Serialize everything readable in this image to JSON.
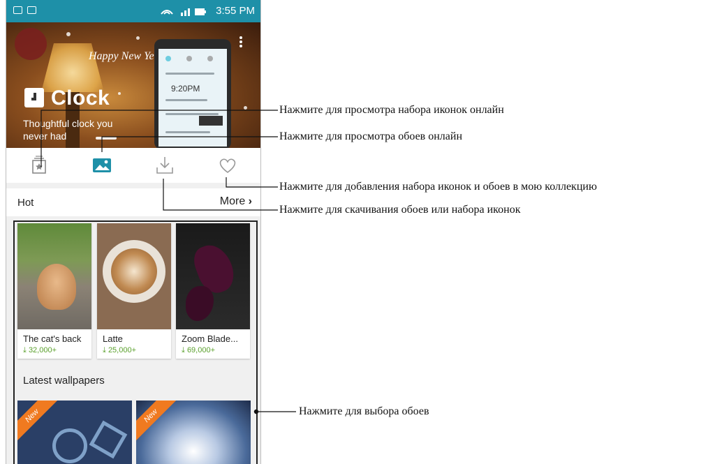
{
  "status_bar": {
    "time": "3:55 PM"
  },
  "banner": {
    "greeting": "Happy New Year",
    "title": "Clock",
    "subtitle": "Thoughtful clock you never had",
    "mock_time": "9:20PM"
  },
  "tabs": [
    {
      "name": "tab-icon-packs",
      "icon": "icon-pack-icon"
    },
    {
      "name": "tab-wallpapers",
      "icon": "image-icon",
      "selected": true
    },
    {
      "name": "tab-downloads",
      "icon": "download-icon"
    },
    {
      "name": "tab-favorites",
      "icon": "heart-icon"
    }
  ],
  "hot": {
    "title": "Hot",
    "more_label": "More",
    "items": [
      {
        "title": "The cat's back",
        "count": "32,000+"
      },
      {
        "title": "Latte",
        "count": "25,000+"
      },
      {
        "title": "Zoom Blade...",
        "count": "69,000+"
      }
    ]
  },
  "latest": {
    "title": "Latest wallpapers",
    "items": [
      {
        "badge": "New"
      },
      {
        "badge": "New"
      }
    ]
  },
  "callouts": {
    "icon_packs_online": "Нажмите для просмотра набора иконок онлайн",
    "wallpapers_online": "Нажмите для просмотра обоев онлайн",
    "add_to_collection": "Нажмите для добавления набора иконок и обоев в мою коллекцию",
    "download": "Нажмите для скачивания обоев или набора иконок",
    "select_wallpaper": "Нажмите для выбора обоев"
  },
  "colors": {
    "accent": "#1e90a8",
    "download_count": "#5aa02c",
    "ribbon": "#f07a20"
  }
}
